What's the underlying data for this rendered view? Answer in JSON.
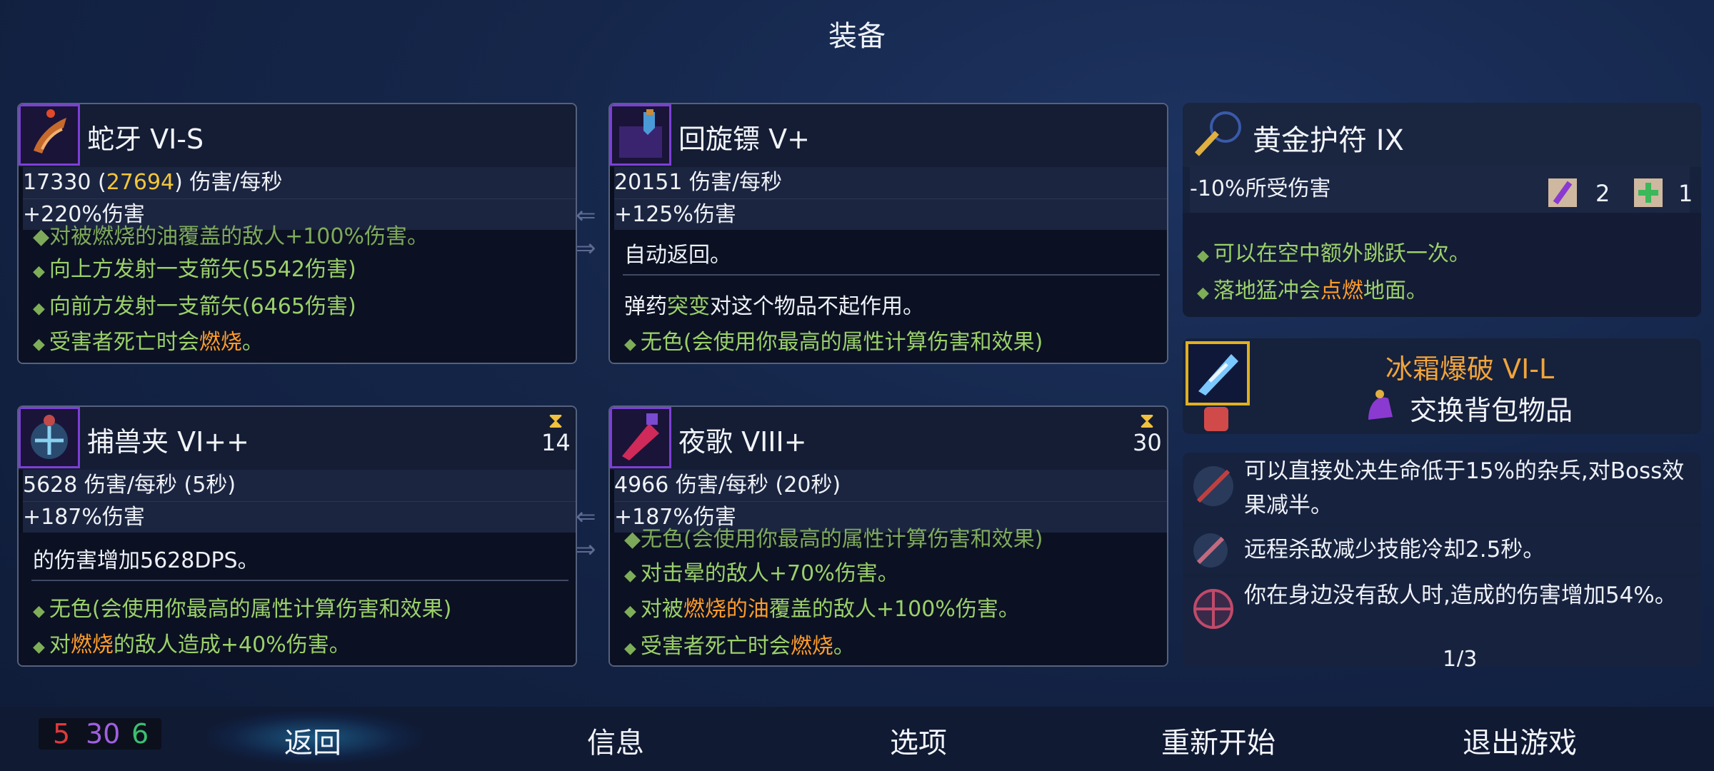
{
  "title": "装备",
  "cards": {
    "snake_fang": {
      "name": "蛇牙 VI-S",
      "dps_base": "17330 (",
      "dps_hl": "27694",
      "dps_tail": ") 伤害/每秒",
      "bonus": "+220%伤害",
      "partial": "◆对被燃烧的油覆盖的敌人+100%伤害。",
      "lines": [
        "向上方发射一支箭矢(5542伤害)",
        "向前方发射一支箭矢(6465伤害)"
      ],
      "last_a": "受害者死亡时会",
      "last_fire": "燃烧",
      "last_b": "。"
    },
    "boomerang": {
      "name": "回旋镖 V+",
      "dps": "20151 伤害/每秒",
      "bonus": "+125%伤害",
      "auto": "自动返回。",
      "ammo_a": "弹药",
      "ammo_hl": "突变",
      "ammo_b": "对这个物品不起作用。",
      "colorless": "无色(会使用你最高的属性计算伤害和效果)"
    },
    "trap": {
      "name": "捕兽夹 VI++",
      "timer": "14",
      "dps": "5628 伤害/每秒 (5秒)",
      "bonus": "+187%伤害",
      "note": "的伤害增加5628DPS。",
      "colorless": "无色(会使用你最高的属性计算伤害和效果)",
      "burn_a": "对",
      "burn_fire": "燃烧",
      "burn_b": "的敌人造成+40%伤害。"
    },
    "nightsong": {
      "name": "夜歌 VIII+",
      "timer": "30",
      "dps": "4966 伤害/每秒 (20秒)",
      "bonus": "+187%伤害",
      "partial": "◆无色(会使用你最高的属性计算伤害和效果)",
      "stun": "对击晕的敌人+70%伤害。",
      "oil_a": "对被",
      "oil_fire": "燃烧的油",
      "oil_b": "覆盖的敌人+100%伤害。",
      "last_a": "受害者死亡时会",
      "last_fire": "燃烧",
      "last_b": "。"
    }
  },
  "amulet": {
    "name": "黄金护符 IX",
    "stat": "-10%所受伤害",
    "scroll_purple_count": "2",
    "scroll_green_count": "1",
    "jump": "可以在空中额外跳跃一次。",
    "slam_a": "落地猛冲会",
    "slam_fire": "点燃",
    "slam_b": "地面。"
  },
  "skill": {
    "name": "冰霜爆破 VI-L",
    "swap": "交换背包物品"
  },
  "mutations": [
    "可以直接处决生命低于15%的杂兵,对Boss效果减半。",
    "远程杀敌减少技能冷却2.5秒。",
    "你在身边没有敌人时,造成的伤害增加54%。"
  ],
  "mutation_count": "1/3",
  "stats": {
    "brutality": "5",
    "tactics": "30",
    "survival": "6"
  },
  "menu": [
    "返回",
    "信息",
    "选项",
    "重新开始",
    "退出游戏"
  ]
}
